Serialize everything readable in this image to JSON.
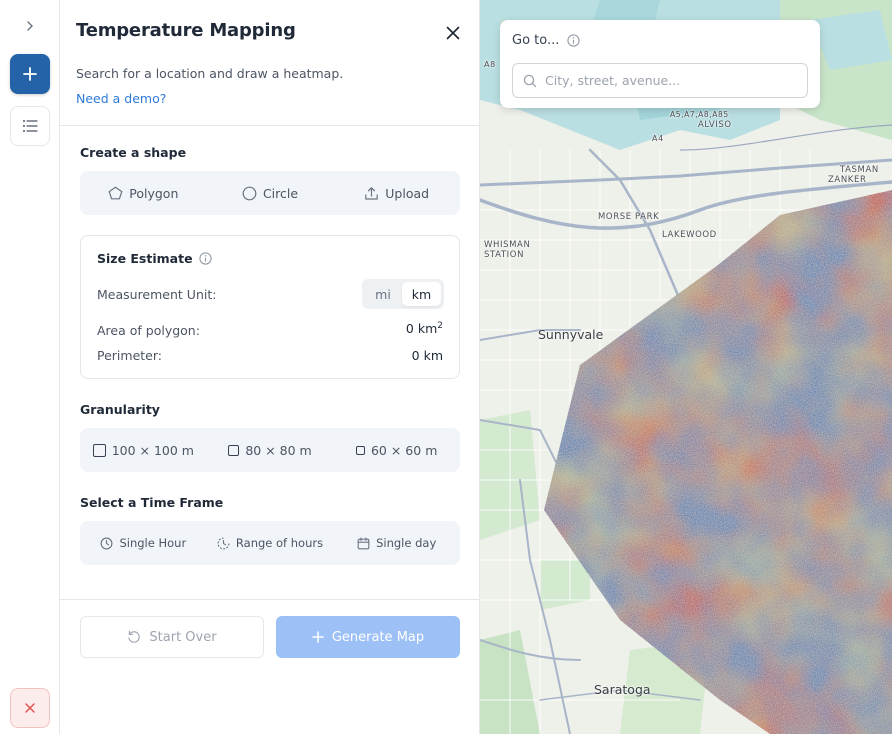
{
  "rail": {
    "expand_icon": "chevron-right-icon",
    "add_icon": "plus-icon",
    "list_icon": "list-icon",
    "close_icon": "close-icon"
  },
  "panel": {
    "title": "Temperature Mapping",
    "subtitle": "Search for a location and draw a heatmap.",
    "demo_link": "Need a demo?"
  },
  "shape": {
    "label": "Create a shape",
    "options": [
      "Polygon",
      "Circle",
      "Upload"
    ]
  },
  "size_estimate": {
    "title": "Size Estimate",
    "unit_label": "Measurement Unit:",
    "units": [
      "mi",
      "km"
    ],
    "selected_unit": "km",
    "area_label": "Area of polygon:",
    "area_value": "0 km",
    "area_sup": "2",
    "perimeter_label": "Perimeter:",
    "perimeter_value": "0 km"
  },
  "granularity": {
    "label": "Granularity",
    "options": [
      "100 × 100 m",
      "80 × 80 m",
      "60 × 60 m"
    ]
  },
  "time_frame": {
    "label": "Select a Time Frame",
    "options": [
      "Single Hour",
      "Range of hours",
      "Single day"
    ]
  },
  "actions": {
    "start_over": "Start Over",
    "generate": "Generate Map"
  },
  "goto": {
    "label": "Go to...",
    "placeholder": "City, street, avenue..."
  },
  "map": {
    "labels": {
      "alviso": "ALVISO",
      "tasman": "TASMAN",
      "zanker": "ZANKER",
      "morse_park": "MORSE PARK",
      "lakewood": "LAKEWOOD",
      "whisman": "WHISMAN",
      "station": "STATION",
      "sunnyvale": "Sunnyvale",
      "saratoga": "Saratoga",
      "a4": "A4",
      "a8": "A8",
      "a5": "A5,A7,A8,A85"
    },
    "colors": {
      "water": "#a8d8dc",
      "park": "#c7e3c4",
      "road": "#a8b4c8",
      "heat_hot": "#c0392b",
      "heat_warm": "#d9a55b",
      "heat_mild": "#8cbf9e",
      "heat_cool": "#3a7bb5"
    }
  }
}
